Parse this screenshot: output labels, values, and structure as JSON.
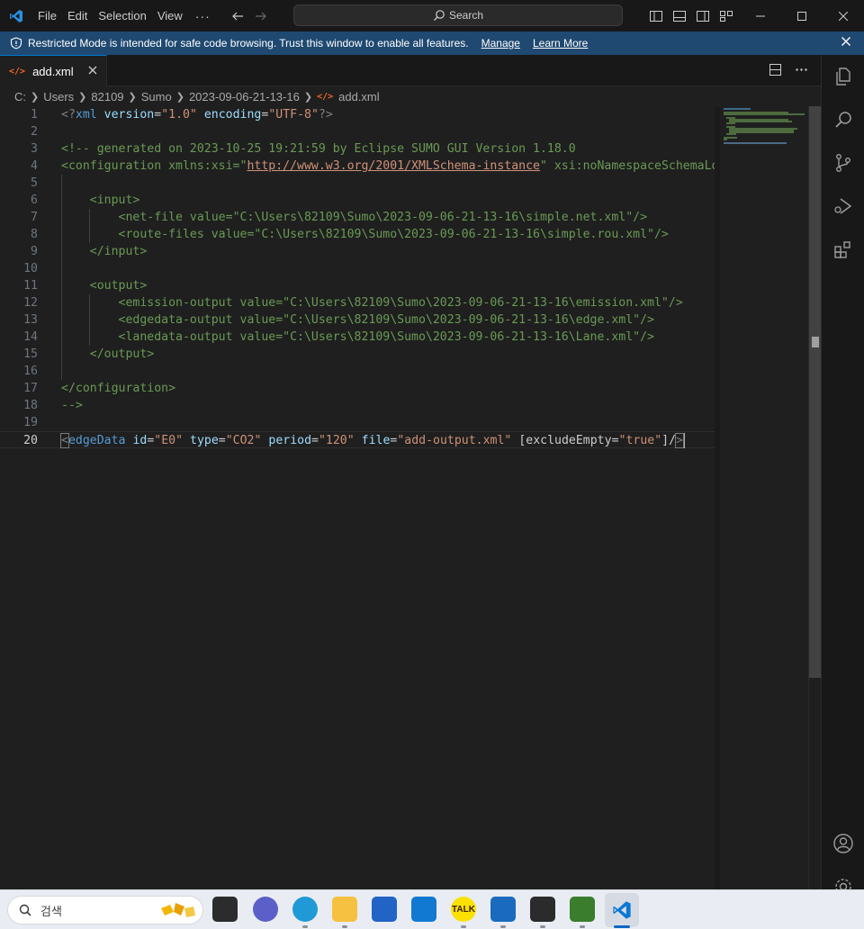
{
  "menu": {
    "file": "File",
    "edit": "Edit",
    "selection": "Selection",
    "view": "View",
    "more": "···"
  },
  "search": {
    "label": "Search"
  },
  "banner": {
    "message": "Restricted Mode is intended for safe code browsing. Trust this window to enable all features.",
    "manage": "Manage",
    "learn_more": "Learn More"
  },
  "tab": {
    "icon_text": "</>",
    "label": "add.xml"
  },
  "breadcrumb": [
    "C:",
    "Users",
    "82109",
    "Sumo",
    "2023-09-06-21-13-16",
    "add.xml"
  ],
  "editor": {
    "current_line": "20",
    "lines": [
      {
        "n": "1"
      },
      {
        "n": "2"
      },
      {
        "n": "3"
      },
      {
        "n": "4"
      },
      {
        "n": "5"
      },
      {
        "n": "6"
      },
      {
        "n": "7"
      },
      {
        "n": "8"
      },
      {
        "n": "9"
      },
      {
        "n": "10"
      },
      {
        "n": "11"
      },
      {
        "n": "12"
      },
      {
        "n": "13"
      },
      {
        "n": "14"
      },
      {
        "n": "15"
      },
      {
        "n": "16"
      },
      {
        "n": "17"
      },
      {
        "n": "18"
      },
      {
        "n": "19"
      },
      {
        "n": "20"
      }
    ],
    "tokens": {
      "l1": [
        "<?",
        "xml",
        " ",
        "version",
        "=",
        "\"1.0\"",
        " ",
        "encoding",
        "=",
        "\"UTF-8\"",
        "?>"
      ],
      "l3": "<!-- generated on 2023-10-25 19:21:59 by Eclipse SUMO GUI Version 1.18.0",
      "l4a": "<configuration xmlns:xsi=\"",
      "l4url": "http://www.w3.org/2001/XMLSchema-instance",
      "l4b": "\" xsi:noNamespaceSchemaLocation=\"http://sumo.dlr.de/xsd/sumoConfiguration.xsd\">",
      "l6": "<input>",
      "l7": "<net-file value=\"C:\\Users\\82109\\Sumo\\2023-09-06-21-13-16\\simple.net.xml\"/>",
      "l8": "<route-files value=\"C:\\Users\\82109\\Sumo\\2023-09-06-21-13-16\\simple.rou.xml\"/>",
      "l9": "</input>",
      "l11": "<output>",
      "l12": "<emission-output value=\"C:\\Users\\82109\\Sumo\\2023-09-06-21-13-16\\emission.xml\"/>",
      "l13": "<edgedata-output value=\"C:\\Users\\82109\\Sumo\\2023-09-06-21-13-16\\edge.xml\"/>",
      "l14": "<lanedata-output value=\"C:\\Users\\82109\\Sumo\\2023-09-06-21-13-16\\Lane.xml\"/>",
      "l15": "</output>",
      "l17": "</configuration>",
      "l18": "-->",
      "l20": {
        "open": "<",
        "tag": "edgeData",
        "a1": "id",
        "v1": "\"E0\"",
        "a2": "type",
        "v2": "\"CO2\"",
        "a3": "period",
        "v3": "\"120\"",
        "a4": "file",
        "v4": "\"add-output.xml\"",
        "a5": "[excludeEmpty",
        "v5": "\"true\"",
        "close": "]/",
        "end": ">"
      }
    }
  },
  "taskbar": {
    "search_label": "검색",
    "kakao_label": "TALK"
  },
  "colors": {
    "accent": "#0078d4",
    "banner": "#1f4971",
    "comment": "#6a9955",
    "tag": "#569cd6",
    "attr": "#9cdcfe",
    "string": "#ce9178"
  }
}
